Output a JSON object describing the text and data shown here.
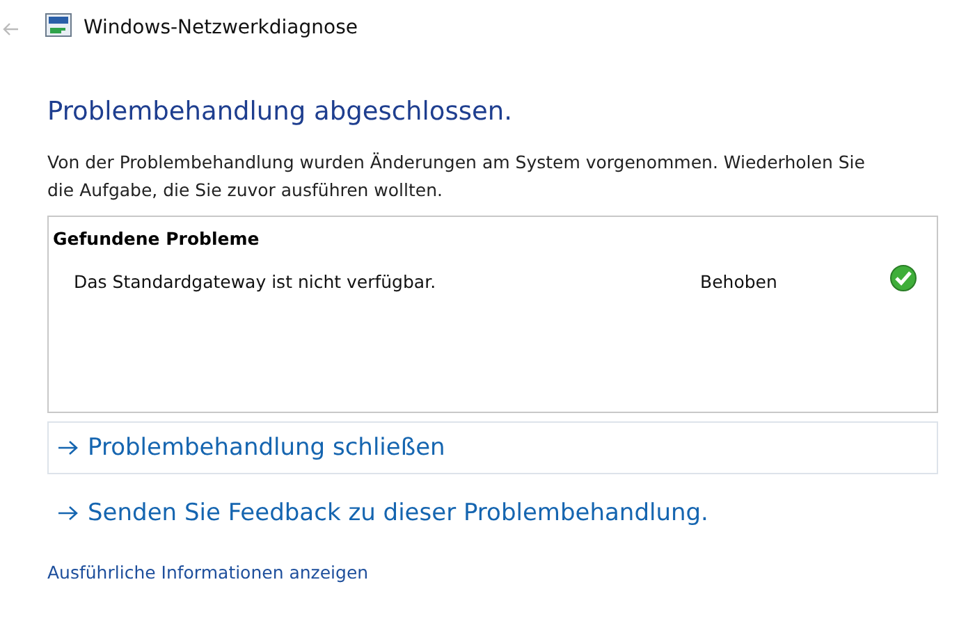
{
  "window": {
    "title": "Windows-Netzwerkdiagnose",
    "back_enabled": false
  },
  "heading": "Problembehandlung abgeschlossen.",
  "message": "Von der Problembehandlung wurden Änderungen am System vorgenommen. Wiederholen Sie die Aufgabe, die Sie zuvor ausführen wollten.",
  "problems": {
    "title": "Gefundene Probleme",
    "rows": [
      {
        "name": "Das Standardgateway ist nicht verfügbar.",
        "status": "Behoben",
        "kind": "fixed"
      }
    ]
  },
  "command_links": [
    {
      "label": "Problembehandlung schließen",
      "selected": true
    },
    {
      "label": "Senden Sie Feedback zu dieser Problembehandlung.",
      "selected": false
    }
  ],
  "details_link": "Ausführliche Informationen anzeigen"
}
